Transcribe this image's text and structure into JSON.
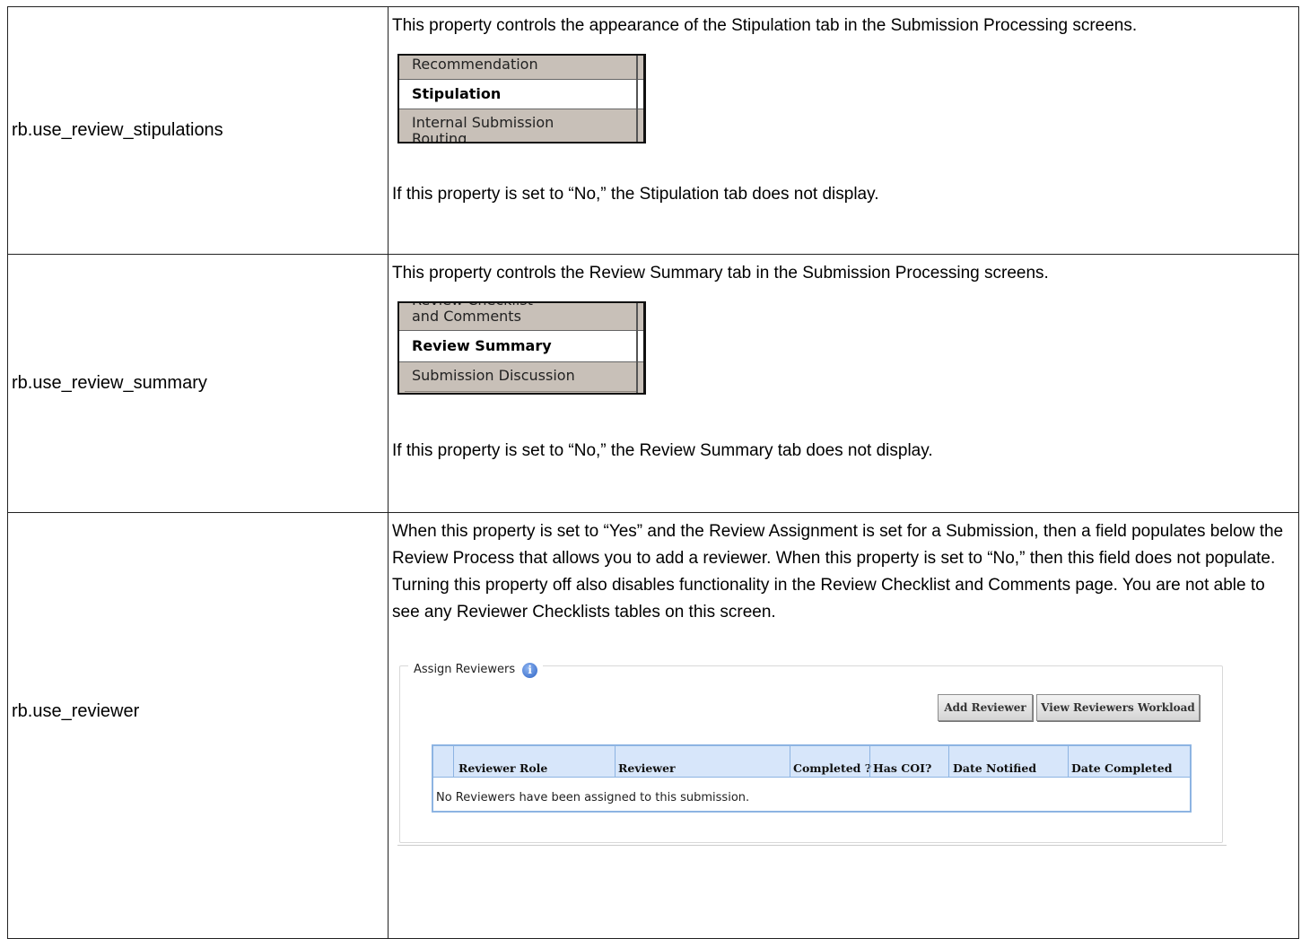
{
  "rows": [
    {
      "name": "rb.use_review_stipulations",
      "intro": "This property controls the appearance of the Stipulation tab in the Submission Processing screens.",
      "tabs": [
        "Recommendation",
        "Stipulation",
        "Internal Submission",
        "Routing"
      ],
      "note": "If this property is set to “No,” the Stipulation tab does not display."
    },
    {
      "name": "rb.use_review_summary",
      "intro": "This property controls the Review Summary tab in the Submission Processing screens.",
      "tabs": [
        "Review Checklist",
        "and Comments",
        "Review Summary",
        "Submission Discussion"
      ],
      "note": "If this property is set to “No,” the Review Summary tab does not display."
    },
    {
      "name": "rb.use_reviewer",
      "intro": "When this property is set to “Yes” and the Review Assignment is set for a Submission, then a field populates below the Review Process that allows you to add a reviewer. When this property is set to “No,” then this field does not populate. Turning this property off also disables functionality in the Review Checklist and Comments page. You are not able to see any Reviewer Checklists tables on this screen."
    }
  ],
  "assign": {
    "legend": "Assign Reviewers",
    "info_icon": "i",
    "add_button": "Add Reviewer",
    "workload_button": "View Reviewers Workload",
    "columns": [
      "Reviewer Role",
      "Reviewer",
      "Completed ?",
      "Has COI?",
      "Date Notified",
      "Date Completed"
    ],
    "empty_message": "No Reviewers have been assigned to this submission."
  }
}
